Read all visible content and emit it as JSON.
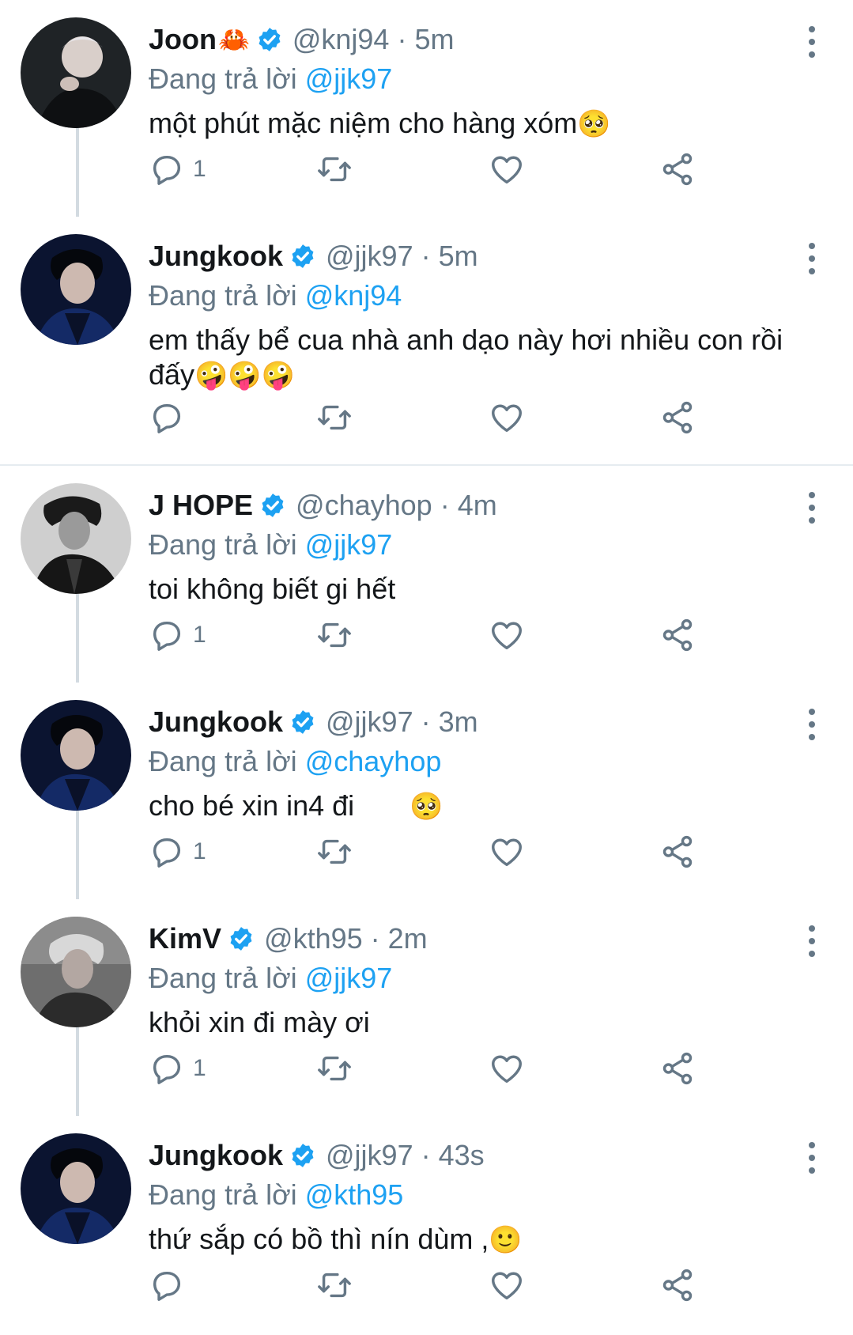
{
  "tweets": [
    {
      "name": "Joon",
      "name_emoji": "🦀",
      "handle": "@knj94",
      "time": "5m",
      "replying_prefix": "Đang trả lời",
      "replying_to": "@jjk97",
      "text": "một phút mặc niệm cho hàng xóm",
      "text_emoji": "🥺",
      "reply_count": "1"
    },
    {
      "name": "Jungkook",
      "name_emoji": "",
      "handle": "@jjk97",
      "time": "5m",
      "replying_prefix": "Đang trả lời",
      "replying_to": "@knj94",
      "text": "em thấy bể cua nhà anh dạo này hơi nhiều con rồi đấy",
      "text_emoji": "🤪🤪🤪",
      "reply_count": ""
    },
    {
      "name": "J HOPE",
      "name_emoji": "",
      "handle": "@chayhop",
      "time": "4m",
      "replying_prefix": "Đang trả lời",
      "replying_to": "@jjk97",
      "text": "toi không biết gi hết",
      "text_emoji": "",
      "reply_count": "1"
    },
    {
      "name": "Jungkook",
      "name_emoji": "",
      "handle": "@jjk97",
      "time": "3m",
      "replying_prefix": "Đang trả lời",
      "replying_to": "@chayhop",
      "text": "cho bé xin in4 đi",
      "text_emoji": "🥺",
      "reply_count": "1"
    },
    {
      "name": "KimV",
      "name_emoji": "",
      "handle": "@kth95",
      "time": "2m",
      "replying_prefix": "Đang trả lời",
      "replying_to": "@jjk97",
      "text": "khỏi xin đi mày ơi",
      "text_emoji": "",
      "reply_count": "1"
    },
    {
      "name": "Jungkook",
      "name_emoji": "",
      "handle": "@jjk97",
      "time": "43s",
      "replying_prefix": "Đang trả lời",
      "replying_to": "@kth95",
      "text": "thứ sắp có bồ thì nín dùm ,",
      "text_emoji": "🙂",
      "reply_count": ""
    }
  ],
  "colors": {
    "accent": "#1da1f2",
    "secondary_text": "#657786",
    "thread_line": "#d3dbe1",
    "divider": "#e6ecf0"
  },
  "icons": {
    "verified": "verified-badge-icon",
    "reply": "reply-bubble-icon",
    "retweet": "retweet-icon",
    "like": "heart-icon",
    "share": "share-icon",
    "menu": "more-vertical-icon"
  }
}
